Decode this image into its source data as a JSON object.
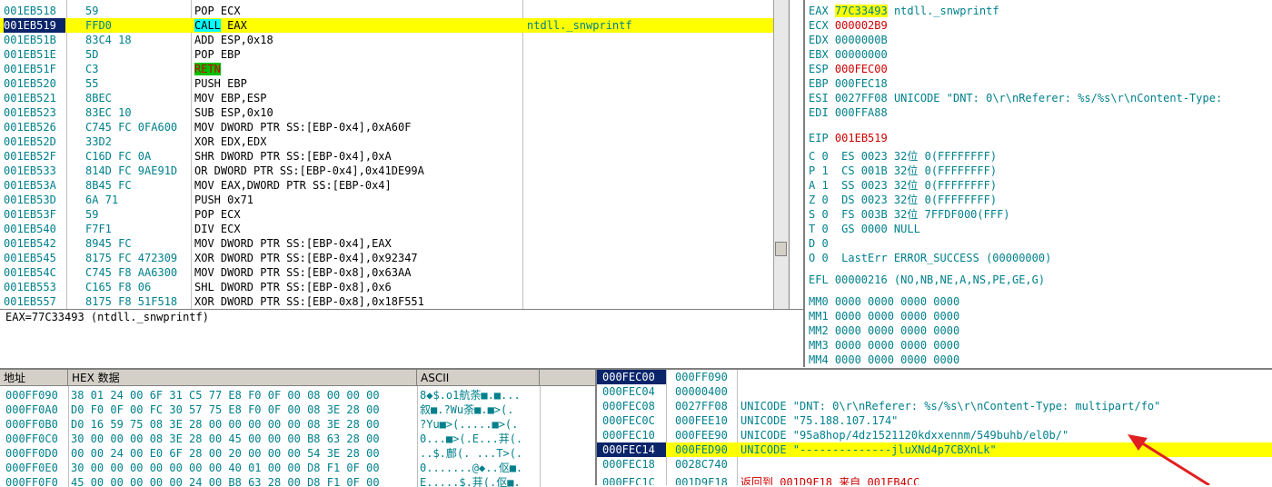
{
  "disasm": {
    "rows": [
      {
        "addr": "001EB518",
        "hex": "59",
        "instr": "POP ECX",
        "comment": ""
      },
      {
        "addr": "001EB519",
        "hex": "FFD0",
        "instr_kw": "CALL",
        "instr_rest": " EAX",
        "comment": "ntdll._snwprintf"
      },
      {
        "addr": "001EB51B",
        "hex": "83C4 18",
        "instr": "ADD ESP,0x18",
        "comment": ""
      },
      {
        "addr": "001EB51E",
        "hex": "5D",
        "instr": "POP EBP",
        "comment": ""
      },
      {
        "addr": "001EB51F",
        "hex": "C3",
        "instr_kw": "RETN",
        "instr_rest": "",
        "comment": ""
      },
      {
        "addr": "001EB520",
        "hex": "55",
        "instr": "PUSH EBP",
        "comment": ""
      },
      {
        "addr": "001EB521",
        "hex": "8BEC",
        "instr": "MOV EBP,ESP",
        "comment": ""
      },
      {
        "addr": "001EB523",
        "hex": "83EC 10",
        "instr": "SUB ESP,0x10",
        "comment": ""
      },
      {
        "addr": "001EB526",
        "hex": "C745 FC 0FA600",
        "instr": "MOV DWORD PTR SS:[EBP-0x4],0xA60F",
        "comment": ""
      },
      {
        "addr": "001EB52D",
        "hex": "33D2",
        "instr": "XOR EDX,EDX",
        "comment": ""
      },
      {
        "addr": "001EB52F",
        "hex": "C16D FC 0A",
        "instr": "SHR DWORD PTR SS:[EBP-0x4],0xA",
        "comment": ""
      },
      {
        "addr": "001EB533",
        "hex": "814D FC 9AE91D",
        "instr": "OR DWORD PTR SS:[EBP-0x4],0x41DE99A",
        "comment": ""
      },
      {
        "addr": "001EB53A",
        "hex": "8B45 FC",
        "instr": "MOV EAX,DWORD PTR SS:[EBP-0x4]",
        "comment": ""
      },
      {
        "addr": "001EB53D",
        "hex": "6A 71",
        "instr": "PUSH 0x71",
        "comment": ""
      },
      {
        "addr": "001EB53F",
        "hex": "59",
        "instr": "POP ECX",
        "comment": ""
      },
      {
        "addr": "001EB540",
        "hex": "F7F1",
        "instr": "DIV ECX",
        "comment": ""
      },
      {
        "addr": "001EB542",
        "hex": "8945 FC",
        "instr": "MOV DWORD PTR SS:[EBP-0x4],EAX",
        "comment": ""
      },
      {
        "addr": "001EB545",
        "hex": "8175 FC 472309",
        "instr": "XOR DWORD PTR SS:[EBP-0x4],0x92347",
        "comment": ""
      },
      {
        "addr": "001EB54C",
        "hex": "C745 F8 AA6300",
        "instr": "MOV DWORD PTR SS:[EBP-0x8],0x63AA",
        "comment": ""
      },
      {
        "addr": "001EB553",
        "hex": "C165 F8 06",
        "instr": "SHL DWORD PTR SS:[EBP-0x8],0x6",
        "comment": ""
      },
      {
        "addr": "001EB557",
        "hex": "8175 F8 51F518",
        "instr": "XOR DWORD PTR SS:[EBP-0x8],0x18F551",
        "comment": ""
      }
    ]
  },
  "info_line": "EAX=77C33493 (ntdll._snwprintf)",
  "registers": {
    "gp": [
      {
        "name": "EAX",
        "value": "77C33493",
        "extra": " ntdll._snwprintf"
      },
      {
        "name": "ECX",
        "value": "000002B9",
        "extra": ""
      },
      {
        "name": "EDX",
        "value": "0000000B",
        "extra": ""
      },
      {
        "name": "EBX",
        "value": "00000000",
        "extra": ""
      },
      {
        "name": "ESP",
        "value": "000FEC00",
        "extra": ""
      },
      {
        "name": "EBP",
        "value": "000FEC18",
        "extra": ""
      },
      {
        "name": "ESI",
        "value": "0027FF08",
        "extra": " UNICODE \"DNT: 0\\r\\nReferer: %s/%s\\r\\nContent-Type:"
      },
      {
        "name": "EDI",
        "value": "000FFA88",
        "extra": ""
      }
    ],
    "eip": {
      "name": "EIP",
      "value": "001EB519"
    },
    "flags": [
      "C 0  ES 0023 32位 0(FFFFFFFF)",
      "P 1  CS 001B 32位 0(FFFFFFFF)",
      "A 1  SS 0023 32位 0(FFFFFFFF)",
      "Z 0  DS 0023 32位 0(FFFFFFFF)",
      "S 0  FS 003B 32位 7FFDF000(FFF)",
      "T 0  GS 0000 NULL",
      "D 0",
      "O 0  LastErr ERROR_SUCCESS (00000000)"
    ],
    "efl": "EFL 00000216 (NO,NB,NE,A,NS,PE,GE,G)",
    "mm": [
      "MM0 0000 0000 0000 0000",
      "MM1 0000 0000 0000 0000",
      "MM2 0000 0000 0000 0000",
      "MM3 0000 0000 0000 0000",
      "MM4 0000 0000 0000 0000"
    ]
  },
  "dump": {
    "headers": {
      "addr": "地址",
      "hex": "HEX 数据",
      "ascii": "ASCII"
    },
    "rows": [
      {
        "addr": "000FF090",
        "hex": "38 01 24 00 6F 31 C5 77 E8 F0 0F 00 08 00 00 00",
        "ascii": "8◆$.o1航荼■.■..."
      },
      {
        "addr": "000FF0A0",
        "hex": "D0 F0 0F 00 FC 30 57 75 E8 F0 0F 00 08 3E 28 00",
        "ascii": "叙■.?Wu荼■.■>(."
      },
      {
        "addr": "000FF0B0",
        "hex": "D0 16 59 75 08 3E 28 00 00 00 00 00 08 3E 28 00",
        "ascii": "?Yu■>(.....■>(."
      },
      {
        "addr": "000FF0C0",
        "hex": "30 00 00 00 08 3E 28 00 45 00 00 00 B8 63 28 00",
        "ascii": "0...■>(.E...荓(."
      },
      {
        "addr": "000FF0D0",
        "hex": "00 00 24 00 E0 6F 28 00 20 00 00 00 54 3E 28 00",
        "ascii": "..$.鄜(. ...T>(."
      },
      {
        "addr": "000FF0E0",
        "hex": "30 00 00 00 00 00 00 00 40 01 00 00 D8 F1 0F 00",
        "ascii": "0.......@◆..伛■."
      },
      {
        "addr": "000FF0F0",
        "hex": "45 00 00 00 00 00 24 00 B8 63 28 00 D8 F1 0F 00",
        "ascii": "E.....$.荓(.伛■."
      }
    ]
  },
  "stack": {
    "rows": [
      {
        "addr": "000FEC00",
        "value": "000FF090",
        "comment": ""
      },
      {
        "addr": "000FEC04",
        "value": "00000400",
        "comment": ""
      },
      {
        "addr": "000FEC08",
        "value": "0027FF08",
        "comment": "UNICODE \"DNT: 0\\r\\nReferer: %s/%s\\r\\nContent-Type: multipart/fo\""
      },
      {
        "addr": "000FEC0C",
        "value": "000FEE10",
        "comment": "UNICODE \"75.188.107.174\""
      },
      {
        "addr": "000FEC10",
        "value": "000FEE90",
        "comment": "UNICODE \"95a8hop/4dz1521120kdxxennm/549buhb/el0b/\""
      },
      {
        "addr": "000FEC14",
        "value": "000FED90",
        "comment": "UNICODE \"--------------jluXNd4p7CBXnLk\""
      },
      {
        "addr": "000FEC18",
        "value": "0028C740",
        "comment": ""
      },
      {
        "addr": "000FEC1C",
        "value": "001D9F18",
        "comment": "返回到 001D9F18 来自 001EB4CC"
      }
    ]
  }
}
